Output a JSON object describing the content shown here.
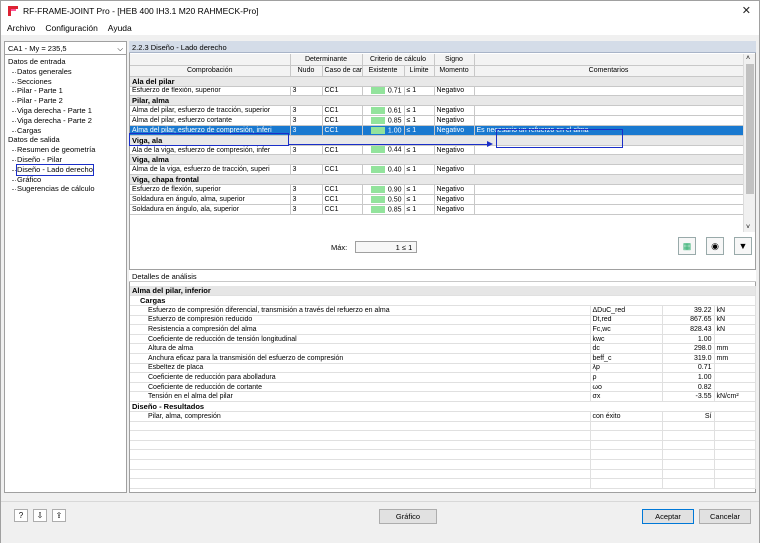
{
  "window": {
    "title": "RF-FRAME-JOINT Pro - [HEB 400 IH3.1 M20 RAHMECK-Pro]",
    "close": "✕"
  },
  "menu": [
    {
      "label": "Archivo"
    },
    {
      "label": "Configuración"
    },
    {
      "label": "Ayuda"
    }
  ],
  "case_selector": {
    "value": "CA1 - My = 235,5"
  },
  "tree": {
    "input_header": "Datos de entrada",
    "input_items": [
      "Datos generales",
      "Secciones",
      "Pilar - Parte 1",
      "Pilar - Parte 2",
      "Viga derecha - Parte 1",
      "Viga derecha - Parte 2",
      "Cargas"
    ],
    "output_header": "Datos de salida",
    "output_items": [
      "Resumen de geometría",
      "Diseño - Pilar",
      "Diseño - Lado derecho",
      "Gráfico",
      "Sugerencias de cálculo"
    ]
  },
  "section_title": "2.2.3 Diseño - Lado derecho",
  "grid": {
    "headers": {
      "comprobacion": "Comprobación",
      "determinante": "Determinante",
      "nudo": "Nudo",
      "caso": "Caso de car",
      "criterio": "Criterio de cálculo",
      "existente": "Existente",
      "limite": "Límite",
      "signo": "Signo",
      "momento": "Momento",
      "comentarios": "Comentarios"
    },
    "rows": [
      {
        "type": "group",
        "label": "Ala del pilar"
      },
      {
        "type": "row",
        "label": "Esfuerzo de flexión, superior",
        "nudo": "3",
        "caso": "CC1",
        "existente": "0.71",
        "limite": "≤ 1",
        "signo": "Negativo",
        "comentario": ""
      },
      {
        "type": "group",
        "label": "Pilar, alma"
      },
      {
        "type": "row",
        "label": "Alma del pilar, esfuerzo de tracción, superior",
        "nudo": "3",
        "caso": "CC1",
        "existente": "0.61",
        "limite": "≤ 1",
        "signo": "Negativo",
        "comentario": ""
      },
      {
        "type": "row",
        "label": "Alma del pilar, esfuerzo cortante",
        "nudo": "3",
        "caso": "CC1",
        "existente": "0.85",
        "limite": "≤ 1",
        "signo": "Negativo",
        "comentario": ""
      },
      {
        "type": "sel",
        "label": "Alma del pilar, esfuerzo de compresión, inferi",
        "nudo": "3",
        "caso": "CC1",
        "existente": "1.00",
        "limite": "≤ 1",
        "signo": "Negativo",
        "comentario": "Es necesario un refuerzo en el alma"
      },
      {
        "type": "group",
        "label": "Viga, ala"
      },
      {
        "type": "row",
        "label": "Ala de la viga, esfuerzo de compresión, infer",
        "nudo": "3",
        "caso": "CC1",
        "existente": "0.44",
        "limite": "≤ 1",
        "signo": "Negativo",
        "comentario": ""
      },
      {
        "type": "group",
        "label": "Viga, alma"
      },
      {
        "type": "row",
        "label": "Alma de la viga, esfuerzo de tracción, superi",
        "nudo": "3",
        "caso": "CC1",
        "existente": "0.40",
        "limite": "≤ 1",
        "signo": "Negativo",
        "comentario": ""
      },
      {
        "type": "group",
        "label": "Viga, chapa frontal"
      },
      {
        "type": "row",
        "label": "Esfuerzo de flexión, superior",
        "nudo": "3",
        "caso": "CC1",
        "existente": "0.90",
        "limite": "≤ 1",
        "signo": "Negativo",
        "comentario": ""
      },
      {
        "type": "row",
        "label": "Soldadura en ángulo, alma, superior",
        "nudo": "3",
        "caso": "CC1",
        "existente": "0.50",
        "limite": "≤ 1",
        "signo": "Negativo",
        "comentario": ""
      },
      {
        "type": "row",
        "label": "Soldadura en ángulo, ala, superior",
        "nudo": "3",
        "caso": "CC1",
        "existente": "0.85",
        "limite": "≤ 1",
        "signo": "Negativo",
        "comentario": ""
      }
    ]
  },
  "max": {
    "label": "Máx:",
    "value": "1",
    "limit": "≤ 1"
  },
  "details": {
    "title": "Detalles de análisis",
    "group1": "Alma del pilar, inferior",
    "sub1": "Cargas",
    "items": [
      {
        "label": "Esfuerzo de compresión diferencial, transmisión a través del refuerzo en alma",
        "sym": "ΔDuC_red",
        "val": "39.22",
        "unit": "kN"
      },
      {
        "label": "Esfuerzo de compresión reducido",
        "sym": "Dt,red",
        "val": "867.65",
        "unit": "kN"
      },
      {
        "label": "Resistencia a compresión del alma",
        "sym": "Fc,wc",
        "val": "828.43",
        "unit": "kN"
      },
      {
        "label": "Coeficiente de reducción de tensión longitudinal",
        "sym": "kwc",
        "val": "1.00",
        "unit": ""
      },
      {
        "label": "Altura de alma",
        "sym": "dc",
        "val": "298.0",
        "unit": "mm"
      },
      {
        "label": "Anchura eficaz para la transmisión del esfuerzo de compresión",
        "sym": "beff_c",
        "val": "319.0",
        "unit": "mm"
      },
      {
        "label": "Esbeltez de placa",
        "sym": "λp",
        "val": "0.71",
        "unit": ""
      },
      {
        "label": "Coeficiente de reducción para abolladura",
        "sym": "ρ",
        "val": "1.00",
        "unit": ""
      },
      {
        "label": "Coeficiente de reducción de cortante",
        "sym": "ωo",
        "val": "0.82",
        "unit": ""
      },
      {
        "label": "Tensión en el alma del pilar",
        "sym": "σx",
        "val": "-3.55",
        "unit": "kN/cm²"
      }
    ],
    "group2": "Diseño - Resultados",
    "result": {
      "label": "Pilar, alma, compresión",
      "sym": "con éxito",
      "val": "Sí"
    }
  },
  "buttons": {
    "grafico": "Gráfico",
    "aceptar": "Aceptar",
    "cancelar": "Cancelar"
  },
  "colors": {
    "selection": "#1979d0",
    "annotation": "#1a2ec8",
    "bar": "#92e39c"
  }
}
